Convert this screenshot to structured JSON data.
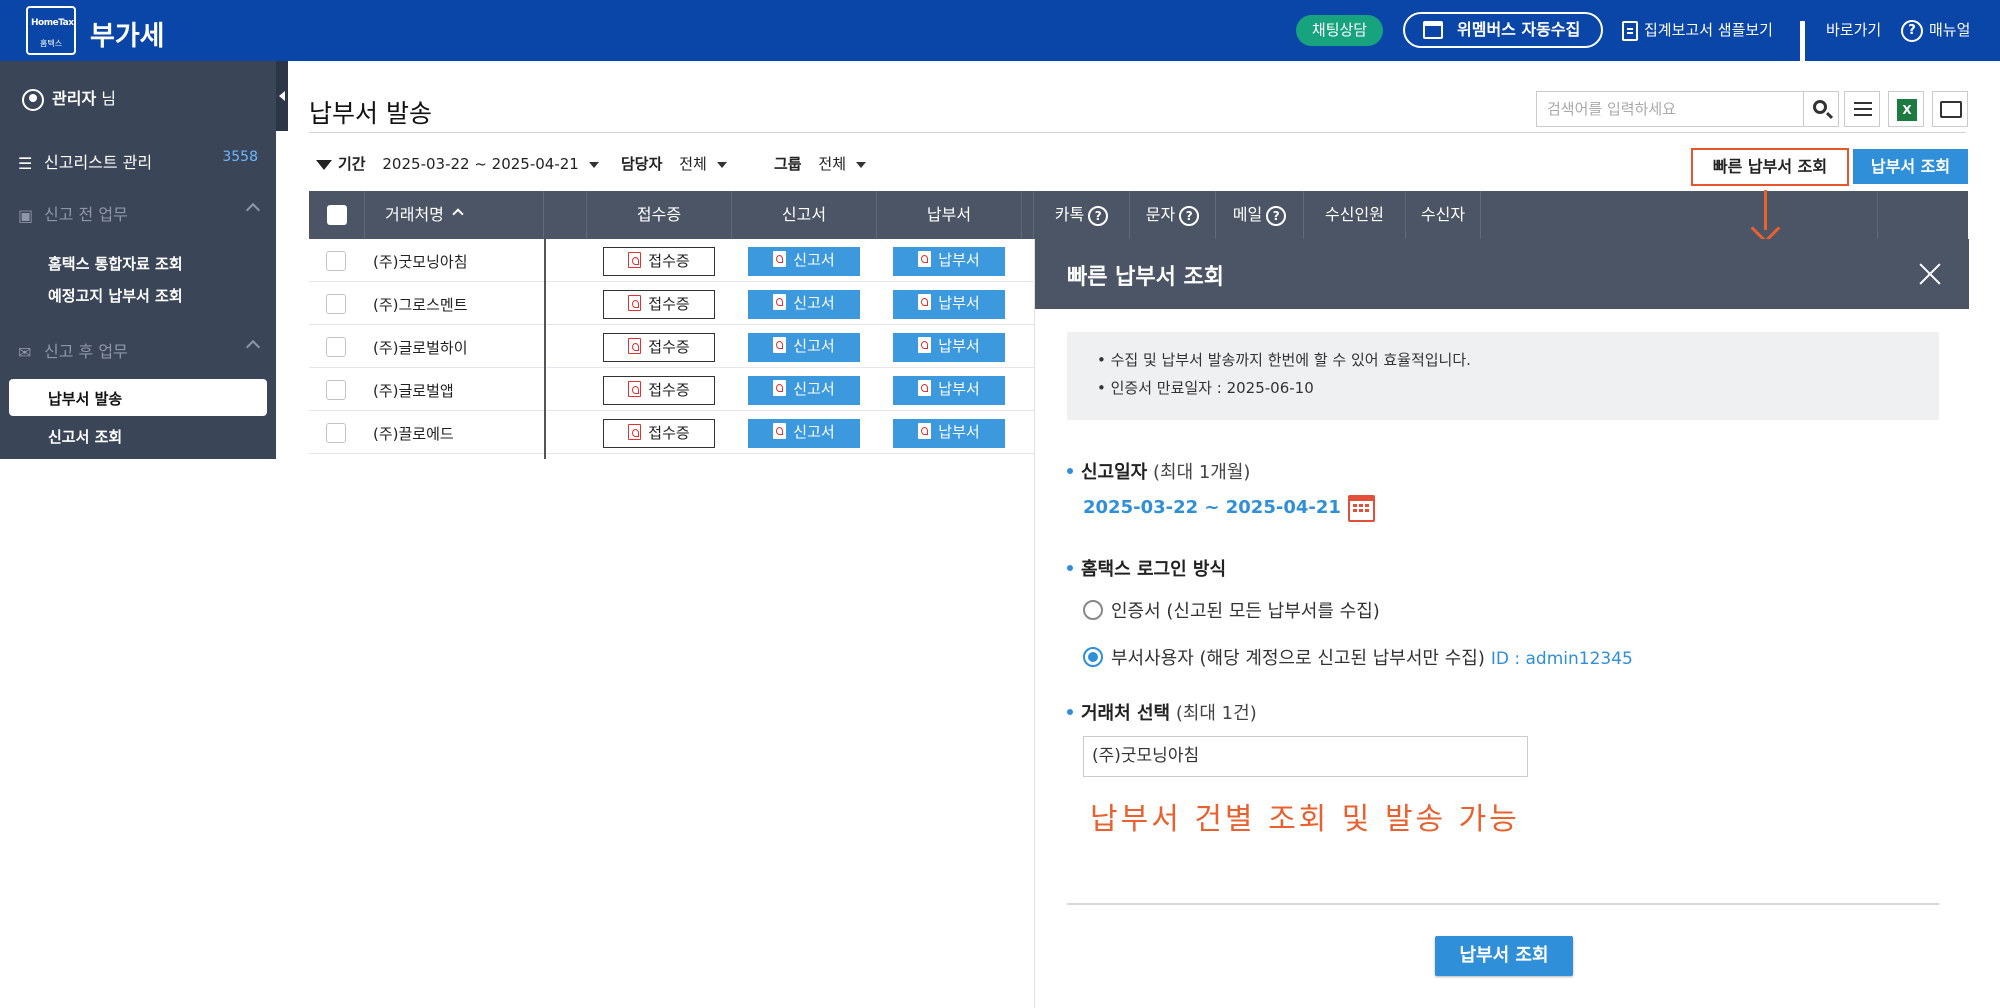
{
  "header": {
    "logo_top": "HomeTax",
    "logo_bottom": "홈텍스",
    "app_title": "부가세",
    "chat_label": "채팅상담",
    "auto_collect_label": "위멤버스 자동수집",
    "report_sample_label": "집계보고서 샘플보기",
    "shortcut_label": "바로가기",
    "manual_label": "매뉴얼"
  },
  "sidebar": {
    "user_name": "관리자",
    "user_suffix": " 님",
    "report_list_label": "신고리스트 관리",
    "report_list_count": "3558",
    "pre_section_label": "신고 전 업무",
    "pre_items": [
      "홈택스 통합자료 조회",
      "예정고지 납부서 조회"
    ],
    "post_section_label": "신고 후 업무",
    "post_items": [
      "납부서 발송",
      "신고서 조회"
    ]
  },
  "main": {
    "page_title": "납부서 발송",
    "search_placeholder": "검색어를 입력하세요",
    "filter": {
      "period_label": "기간",
      "period_value": "2025-03-22 ~ 2025-04-21",
      "manager_label": "담당자",
      "manager_value": "전체",
      "group_label": "그룹",
      "group_value": "전체"
    },
    "quick_query_label": "빠른 납부서 조회",
    "query_label": "납부서 조회",
    "columns": [
      "거래처명",
      "접수증",
      "신고서",
      "납부서",
      "카톡",
      "문자",
      "메일",
      "수신인원",
      "수신자"
    ],
    "help_mark": "?",
    "excel_label": "X",
    "btn_receipt": "접수증",
    "btn_report": "신고서",
    "btn_payment": "납부서",
    "rows": [
      "(주)굿모닝아침",
      "(주)그로스멘트",
      "(주)글로벌하이",
      "(주)글로벌앱",
      "(주)끌로에드"
    ]
  },
  "panel": {
    "title": "빠른 납부서 조회",
    "info": [
      "• 수집 및 납부서 발송까지 한번에 할 수 있어 효율적입니다.",
      "• 인증서 만료일자 : 2025-06-10"
    ],
    "date_label": "신고일자",
    "date_hint": "(최대 1개월)",
    "date_value": "2025-03-22 ~ 2025-04-21",
    "login_label": "홈택스 로그인 방식",
    "option_cert": "인증서 (신고된 모든 납부서를 수집)",
    "option_dept": "부서사용자 (해당 계정으로 신고된 납부서만 수집)",
    "dept_id": "ID : admin12345",
    "client_label": "거래처 선택",
    "client_hint": "(최대 1건)",
    "client_value": "(주)굿모닝아침",
    "note": "납부서 건별 조회 및 발송 가능",
    "submit_label": "납부서 조회"
  }
}
